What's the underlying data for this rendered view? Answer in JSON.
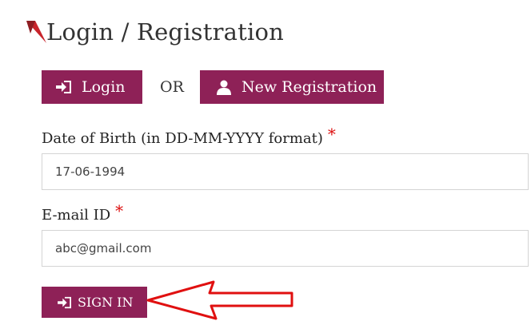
{
  "header": {
    "title": "Login / Registration"
  },
  "tabs": {
    "login_label": "Login",
    "or_label": "OR",
    "registration_label": "New Registration"
  },
  "form": {
    "dob": {
      "label": "Date of Birth (in DD-MM-YYYY format)",
      "required_mark": "*",
      "value": "17-06-1994"
    },
    "email": {
      "label": "E-mail ID",
      "required_mark": "*",
      "value": "abc@gmail.com"
    },
    "submit_label": "SIGN IN"
  },
  "icons": {
    "title_mark": "red-triangle-icon",
    "login": "sign-in-icon",
    "registration": "user-icon",
    "submit": "sign-in-icon",
    "annotation": "red-arrow-icon"
  },
  "colors": {
    "accent": "#8e2157",
    "required": "#dd1111",
    "annotation": "#e01010",
    "title_mark": "#c8242b"
  }
}
